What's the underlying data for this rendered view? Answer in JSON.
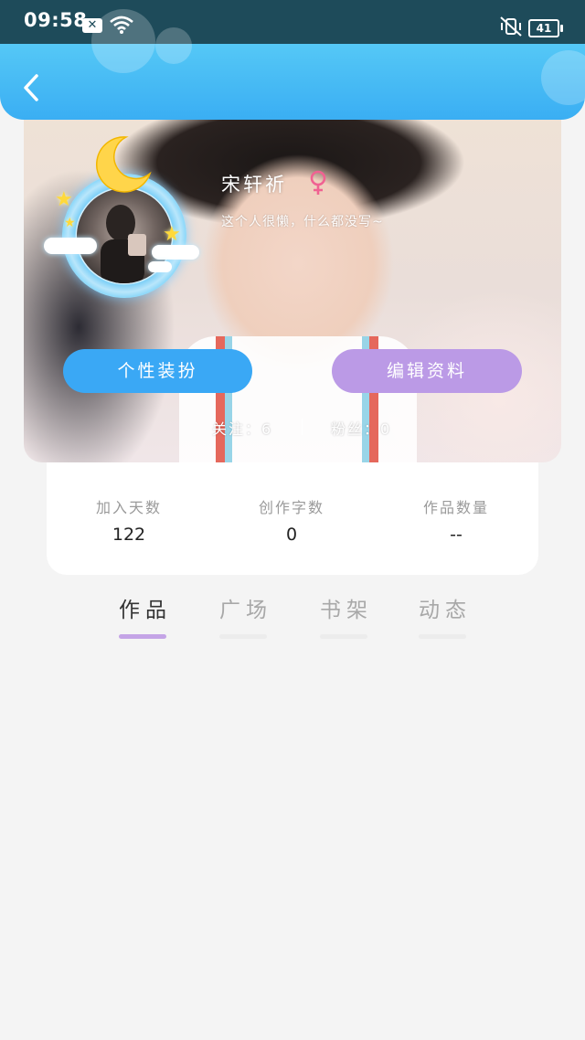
{
  "status_bar": {
    "time": "09:58",
    "battery": "41"
  },
  "profile": {
    "username": "宋轩祈",
    "bio": "这个人很懒，什么都没写~",
    "follow_label": "关注：6",
    "fans_label": "粉丝：0"
  },
  "buttons": {
    "style_label": "个性装扮",
    "edit_label": "编辑资料"
  },
  "stats": [
    {
      "label": "加入天数",
      "value": "122"
    },
    {
      "label": "创作字数",
      "value": "0"
    },
    {
      "label": "作品数量",
      "value": "--"
    }
  ],
  "tabs": [
    {
      "label": "作品",
      "active": true
    },
    {
      "label": "广场",
      "active": false
    },
    {
      "label": "书架",
      "active": false
    },
    {
      "label": "动态",
      "active": false
    }
  ],
  "colors": {
    "header": "#3aaef3",
    "style_button": "#3aa8f5",
    "edit_button": "#bb9ae6",
    "tab_indicator": "#c4a4e6",
    "gender": "#f06292"
  },
  "icons": {
    "back": "chevron-left-icon",
    "gender": "female-icon",
    "wifi": "wifi-icon",
    "vibrate": "vibrate-off-icon",
    "notification": "notification-icon",
    "moon": "moon-icon",
    "star": "star-icon"
  }
}
